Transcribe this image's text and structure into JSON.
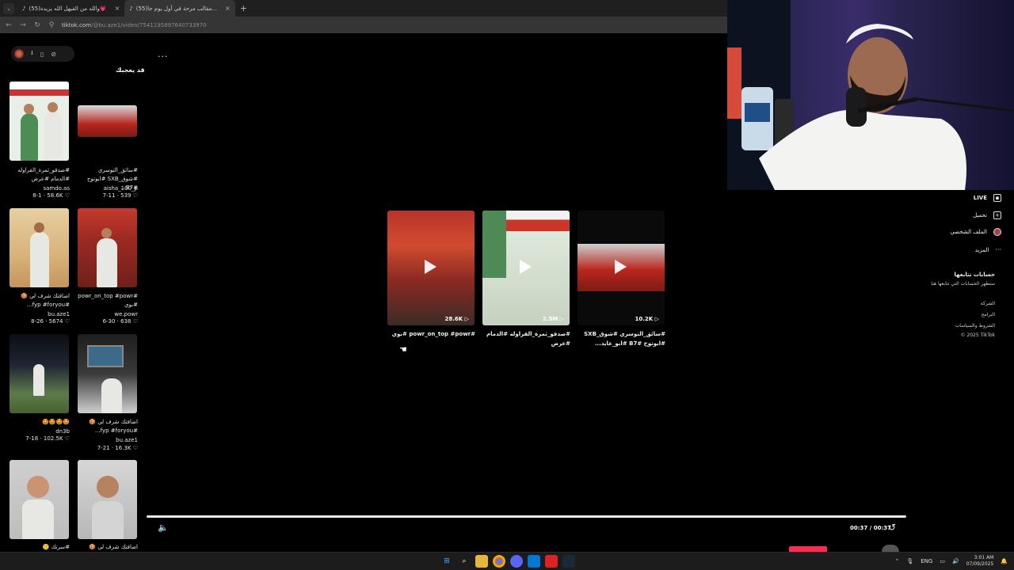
{
  "browser": {
    "tabs": [
      {
        "label": "(55)والله من القيهل الله يزيدة💗",
        "close": "×"
      },
      {
        "label": "(55)مقالب مرحة في أول يوم جا...",
        "close": "×"
      }
    ],
    "new_tab": "+",
    "url_host": "tiktok.com",
    "url_path": "/@bu.aze1/video/7541195897640733970"
  },
  "feed": {
    "more": "...",
    "section_title": "قد يعجبك",
    "cards": [
      {
        "caption": "#صدقو_ثمرة_القراوله #الدمام #عرض",
        "author": "samdo.as",
        "stats": "8-1 · 58.6K ♡"
      },
      {
        "caption": "#سائق_التوسري #شوق_SXB #ابوتوح #B7...",
        "author": "aisha_100_p",
        "stats": "7-11 · 539 ♡"
      },
      {
        "caption": "اضافتك شرف لي 🍪 #fyp #foryou...",
        "author": "bu.aze1",
        "stats": "8-26 · 5674 ♡"
      },
      {
        "caption": "#powr_on_top #powr #بوي",
        "author": "we.powr",
        "stats": "6-30 · 638 ♡"
      },
      {
        "caption": "🤩🤩🤩🤩",
        "author": "dn3b",
        "stats": "7-18 · 102.5K ♡"
      },
      {
        "caption": "اضافتك شرف لي 🍪 #fyp #foryou...",
        "author": "bu.aze1",
        "stats": "7-21 · 16.3K ♡"
      },
      {
        "caption": "#سرتك 🤫",
        "author": "",
        "stats": ""
      },
      {
        "caption": "اضافتك شرف لي 🍪 #fyp",
        "author": "",
        "stats": ""
      }
    ]
  },
  "videos": [
    {
      "count": "28.6K ▷",
      "caption": "#powr_on_top #powr #بوي"
    },
    {
      "count": "2.5M ▷",
      "caption": "#صدقو_ثمرة_القراوله #الدمام #عرض"
    },
    {
      "count": "10.2K ▷",
      "caption": "#سائق_التوسري #شوق_SXB #ابوتوح #B7 #ابو_عايد..."
    }
  ],
  "right_panel": {
    "live": "LIVE",
    "upload": "تحميل",
    "profile": "الملف الشخصي",
    "more": "المزيد",
    "following_title": "حسابات تتابعها",
    "following_hint": "ستظهر الحسابات التي تتابعها هنا",
    "company": "الشركة",
    "programs": "البرامج",
    "terms": "الشروط والسياسات",
    "copyright": "© 2025 TikTok"
  },
  "player": {
    "time": "00:37 / 00:37",
    "progress": 1.0
  },
  "taskbar": {
    "lang": "ENG",
    "time": "3:01 AM",
    "date": "07/09/2025"
  },
  "colors": {
    "accent": "#fe2c55",
    "background": "#000000"
  }
}
